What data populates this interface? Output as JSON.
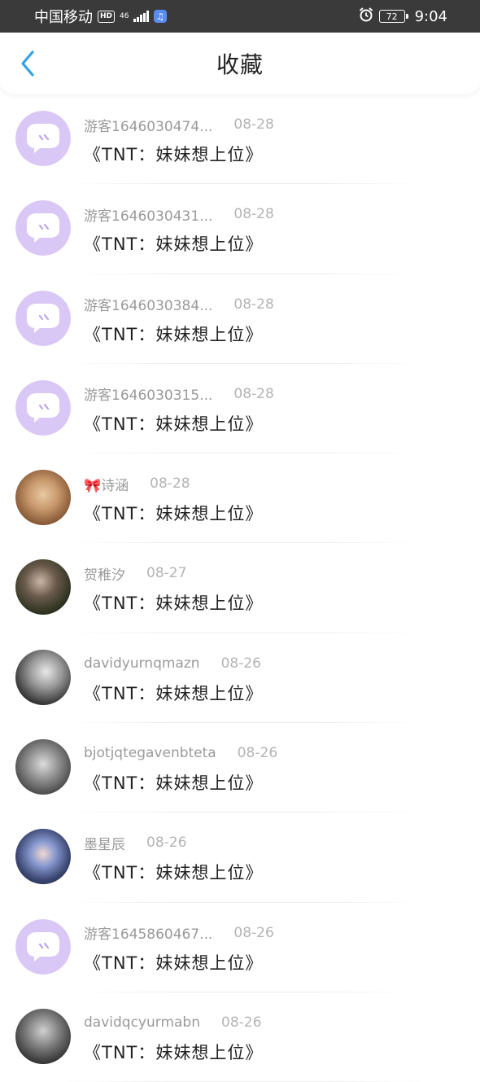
{
  "status_bar": {
    "carrier": "中国移动",
    "hd": "HD",
    "network": "46",
    "battery": "72",
    "time": "9:04"
  },
  "nav": {
    "title": "收藏"
  },
  "items": [
    {
      "name": "游客1646030474...",
      "date": "08-28",
      "work": "《TNT：妹妹想上位》",
      "avatar": "chat-bubble"
    },
    {
      "name": "游客1646030431...",
      "date": "08-28",
      "work": "《TNT：妹妹想上位》",
      "avatar": "chat-bubble"
    },
    {
      "name": "游客1646030384...",
      "date": "08-28",
      "work": "《TNT：妹妹想上位》",
      "avatar": "chat-bubble"
    },
    {
      "name": "游客1646030315...",
      "date": "08-28",
      "work": "《TNT：妹妹想上位》",
      "avatar": "chat-bubble"
    },
    {
      "name": "🎀诗涵",
      "date": "08-28",
      "work": "《TNT：妹妹想上位》",
      "avatar": "photo"
    },
    {
      "name": "贺稚汐",
      "date": "08-27",
      "work": "《TNT：妹妹想上位》",
      "avatar": "photo"
    },
    {
      "name": "davidyurnqmazn",
      "date": "08-26",
      "work": "《TNT：妹妹想上位》",
      "avatar": "photo"
    },
    {
      "name": "bjotjqtegavenbteta",
      "date": "08-26",
      "work": "《TNT：妹妹想上位》",
      "avatar": "photo"
    },
    {
      "name": "墨星辰",
      "date": "08-26",
      "work": "《TNT：妹妹想上位》",
      "avatar": "photo"
    },
    {
      "name": "游客1645860467...",
      "date": "08-26",
      "work": "《TNT：妹妹想上位》",
      "avatar": "chat-bubble"
    },
    {
      "name": "davidqcyurmabn",
      "date": "08-26",
      "work": "《TNT：妹妹想上位》",
      "avatar": "photo"
    }
  ]
}
